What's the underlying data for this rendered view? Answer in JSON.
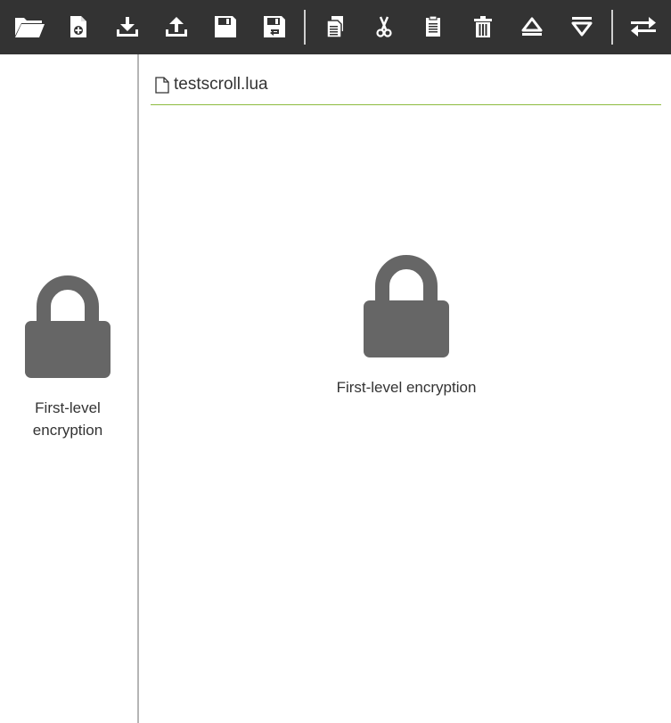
{
  "toolbar": {
    "buttons": [
      {
        "name": "open-folder",
        "icon": "folder-open-icon"
      },
      {
        "name": "new-file",
        "icon": "file-plus-icon"
      },
      {
        "name": "download",
        "icon": "download-icon"
      },
      {
        "name": "upload",
        "icon": "upload-icon"
      },
      {
        "name": "save",
        "icon": "floppy-disk-icon"
      },
      {
        "name": "save-as",
        "icon": "floppy-disk-arrow-icon"
      },
      {
        "name": "copy",
        "icon": "copy-icon"
      },
      {
        "name": "cut",
        "icon": "scissors-icon"
      },
      {
        "name": "paste",
        "icon": "clipboard-icon"
      },
      {
        "name": "delete",
        "icon": "trash-icon"
      },
      {
        "name": "eject",
        "icon": "eject-icon"
      },
      {
        "name": "insert",
        "icon": "insert-icon"
      },
      {
        "name": "transfer",
        "icon": "swap-arrows-icon"
      }
    ],
    "background": "#333333",
    "icon_color": "#ffffff"
  },
  "sidebar": {
    "lock_icon": "lock-icon",
    "caption": "First-level encryption"
  },
  "main": {
    "file_icon": "file-outline-icon",
    "file_name": "testscroll.lua",
    "lock_icon": "lock-icon",
    "caption": "First-level encryption",
    "header_underline_color": "#8dbb3f"
  },
  "colors": {
    "lock": "#666666",
    "text": "#333333",
    "divider": "#b5b5b5"
  }
}
